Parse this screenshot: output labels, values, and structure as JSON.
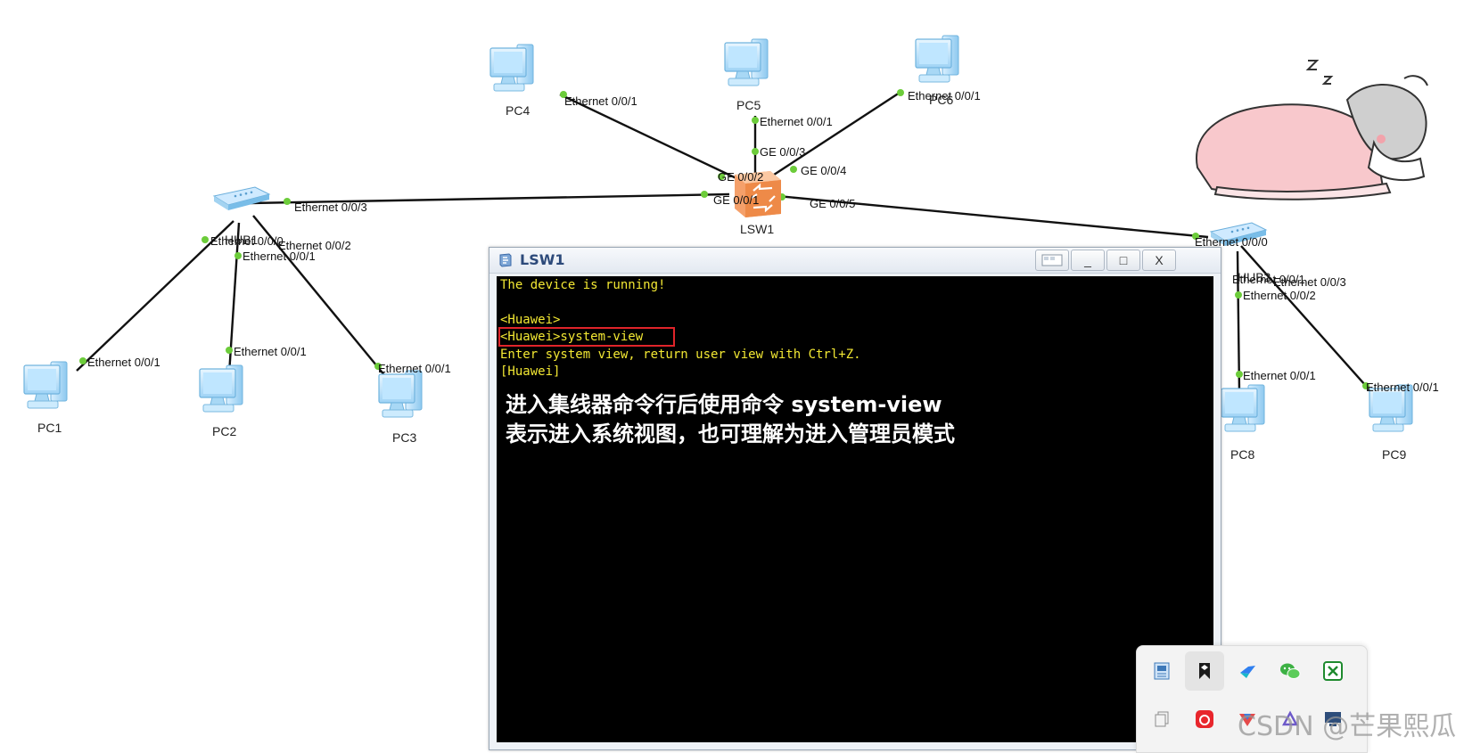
{
  "topology": {
    "switch": "LSW1",
    "hubs": [
      "HUB1",
      "HUB2"
    ],
    "pcs": [
      "PC1",
      "PC2",
      "PC3",
      "PC4",
      "PC5",
      "PC6",
      "PC8",
      "PC9"
    ],
    "ports": {
      "pc4_eth": "Ethernet 0/0/1",
      "pc5_eth": "Ethernet 0/0/1",
      "pc6_eth": "Ethernet 0/0/1",
      "lsw1_ge003": "GE 0/0/3",
      "lsw1_ge004": "GE 0/0/4",
      "lsw1_ge002": "GE 0/0/2",
      "lsw1_ge001": "GE 0/0/1",
      "lsw1_ge005": "GE 0/0/5",
      "hub1_eth003": "Ethernet 0/0/3",
      "hub1_eth000": "Ethernet 0/0/0",
      "hub1_eth002": "Ethernet 0/0/2",
      "hub1_eth001": "Ethernet 0/0/1",
      "pc1_eth": "Ethernet 0/0/1",
      "pc2_eth": "Ethernet 0/0/1",
      "pc3_eth": "Ethernet 0/0/1",
      "hub2_eth000": "Ethernet 0/0/0",
      "hub2_eth001": "Ethernet 0/0/1",
      "hub2_eth003": "Ethernet 0/0/3",
      "hub2_eth002": "Ethernet 0/0/2",
      "pc8_eth": "Ethernet 0/0/1",
      "pc9_eth": "Ethernet 0/0/1"
    }
  },
  "console": {
    "title": "LSW1",
    "buttons": {
      "minimize": "_",
      "maximize": "□",
      "close": "X"
    },
    "lines": [
      "The device is running!",
      "",
      "<Huawei>",
      "<Huawei>system-view",
      "Enter system view, return user view with Ctrl+Z.",
      "[Huawei]"
    ],
    "annotation": [
      "进入集线器命令行后使用命令 system-view",
      "表示进入系统视图，也可理解为进入管理员模式"
    ]
  },
  "tray": {
    "icons": [
      "network-card-icon",
      "bookmark-icon",
      "feishu-icon",
      "wechat-icon",
      "xbox-icon",
      "copy-icon",
      "netease-music-icon",
      "xunlei-icon",
      "drive-icon",
      "monitor-icon"
    ]
  },
  "watermark": "CSDN @芒果熙瓜",
  "colors": {
    "link_dot": "#6ccc3a",
    "terminal_text": "#f3e833",
    "highlight_box": "#e0242a"
  }
}
